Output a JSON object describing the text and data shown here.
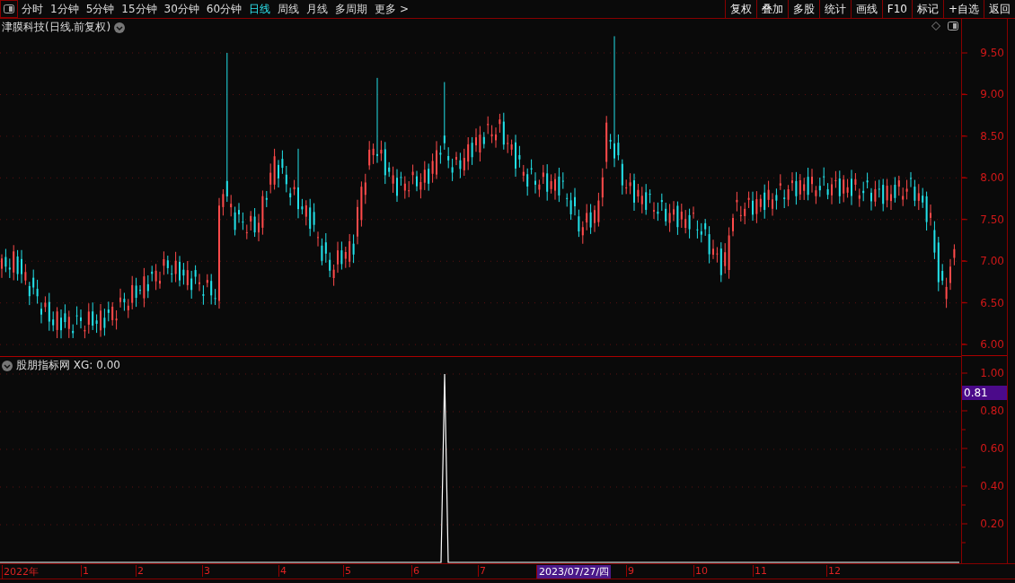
{
  "toolbar": {
    "periods": [
      {
        "label": "分时",
        "selected": false
      },
      {
        "label": "1分钟",
        "selected": false
      },
      {
        "label": "5分钟",
        "selected": false
      },
      {
        "label": "15分钟",
        "selected": false
      },
      {
        "label": "30分钟",
        "selected": false
      },
      {
        "label": "60分钟",
        "selected": false
      },
      {
        "label": "日线",
        "selected": true
      },
      {
        "label": "周线",
        "selected": false
      },
      {
        "label": "月线",
        "selected": false
      },
      {
        "label": "多周期",
        "selected": false
      },
      {
        "label": "更多 >",
        "selected": false
      }
    ],
    "buttons": [
      "复权",
      "叠加",
      "多股",
      "统计",
      "画线",
      "F10",
      "标记",
      "+自选",
      "返回"
    ]
  },
  "price_panel": {
    "title": "津膜科技(日线.前复权)",
    "axis_labels": [
      "9.50",
      "9.00",
      "8.50",
      "8.00",
      "7.50",
      "7.00",
      "6.50",
      "6.00"
    ]
  },
  "indicator_panel": {
    "title": "股朋指标网 XG: 0.00",
    "axis_labels": [
      "1.00",
      "0.80",
      "0.60",
      "0.40",
      "0.20"
    ],
    "cursor_value": "0.81"
  },
  "time_axis": {
    "labels": [
      {
        "text": "2022年",
        "selected": false
      },
      {
        "text": "1",
        "selected": false
      },
      {
        "text": "2",
        "selected": false
      },
      {
        "text": "3",
        "selected": false
      },
      {
        "text": "4",
        "selected": false
      },
      {
        "text": "5",
        "selected": false
      },
      {
        "text": "6",
        "selected": false
      },
      {
        "text": "7",
        "selected": false
      },
      {
        "text": "2023/07/27/四",
        "selected": true
      },
      {
        "text": "9",
        "selected": false
      },
      {
        "text": "10",
        "selected": false
      },
      {
        "text": "11",
        "selected": false
      },
      {
        "text": "12",
        "selected": false
      }
    ]
  }
}
